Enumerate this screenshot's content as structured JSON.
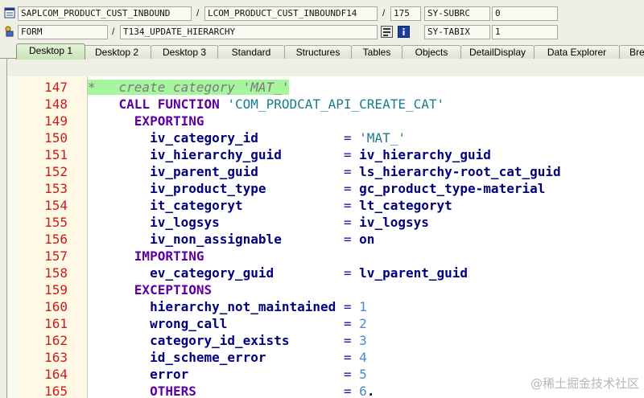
{
  "debug_fields": {
    "row1": {
      "program": "SAPLCOM_PRODUCT_CUST_INBOUND",
      "include": "LCOM_PRODUCT_CUST_INBOUNDF14",
      "line": "175",
      "sysvar_name": "SY-SUBRC",
      "sysvar_value": "0"
    },
    "row2": {
      "event_type": "FORM",
      "event_name": "T134_UPDATE_HIERARCHY",
      "sysvar_name": "SY-TABIX",
      "sysvar_value": "1"
    },
    "separator": "/"
  },
  "tabs": [
    "Desktop 1",
    "Desktop 2",
    "Desktop 3",
    "Standard",
    "Structures",
    "Tables",
    "Objects",
    "DetailDisplay",
    "Data Explorer",
    "Bre"
  ],
  "active_tab": "Desktop 1",
  "code_lines": [
    {
      "n": "147",
      "tokens": [
        {
          "t": "*   create category 'MAT_'",
          "c": "cmt"
        }
      ]
    },
    {
      "n": "148",
      "tokens": [
        {
          "t": "    "
        },
        {
          "t": "CALL FUNCTION",
          "c": "kw"
        },
        {
          "t": " "
        },
        {
          "t": "'COM_PRODCAT_API_CREATE_CAT'",
          "c": "str"
        }
      ]
    },
    {
      "n": "149",
      "tokens": [
        {
          "t": "      "
        },
        {
          "t": "EXPORTING",
          "c": "kw"
        }
      ]
    },
    {
      "n": "150",
      "tokens": [
        {
          "t": "        "
        },
        {
          "t": "iv_category_id",
          "c": "id"
        },
        {
          "t": "           "
        },
        {
          "t": "=",
          "c": "op"
        },
        {
          "t": " "
        },
        {
          "t": "'MAT_'",
          "c": "str"
        }
      ]
    },
    {
      "n": "151",
      "tokens": [
        {
          "t": "        "
        },
        {
          "t": "iv_hierarchy_guid",
          "c": "id"
        },
        {
          "t": "        "
        },
        {
          "t": "=",
          "c": "op"
        },
        {
          "t": " "
        },
        {
          "t": "iv_hierarchy_guid",
          "c": "id"
        }
      ]
    },
    {
      "n": "152",
      "tokens": [
        {
          "t": "        "
        },
        {
          "t": "iv_parent_guid",
          "c": "id"
        },
        {
          "t": "           "
        },
        {
          "t": "=",
          "c": "op"
        },
        {
          "t": " "
        },
        {
          "t": "ls_hierarchy-root_cat_guid",
          "c": "id"
        }
      ]
    },
    {
      "n": "153",
      "tokens": [
        {
          "t": "        "
        },
        {
          "t": "iv_product_type",
          "c": "id"
        },
        {
          "t": "          "
        },
        {
          "t": "=",
          "c": "op"
        },
        {
          "t": " "
        },
        {
          "t": "gc_product_type-material",
          "c": "id"
        }
      ]
    },
    {
      "n": "154",
      "tokens": [
        {
          "t": "        "
        },
        {
          "t": "it_categoryt",
          "c": "id"
        },
        {
          "t": "             "
        },
        {
          "t": "=",
          "c": "op"
        },
        {
          "t": " "
        },
        {
          "t": "lt_categoryt",
          "c": "id"
        }
      ]
    },
    {
      "n": "155",
      "tokens": [
        {
          "t": "        "
        },
        {
          "t": "iv_logsys",
          "c": "id"
        },
        {
          "t": "                "
        },
        {
          "t": "=",
          "c": "op"
        },
        {
          "t": " "
        },
        {
          "t": "iv_logsys",
          "c": "id"
        }
      ]
    },
    {
      "n": "156",
      "tokens": [
        {
          "t": "        "
        },
        {
          "t": "iv_non_assignable",
          "c": "id"
        },
        {
          "t": "        "
        },
        {
          "t": "=",
          "c": "op"
        },
        {
          "t": " "
        },
        {
          "t": "on",
          "c": "id"
        }
      ]
    },
    {
      "n": "157",
      "tokens": [
        {
          "t": "      "
        },
        {
          "t": "IMPORTING",
          "c": "kw"
        }
      ]
    },
    {
      "n": "158",
      "tokens": [
        {
          "t": "        "
        },
        {
          "t": "ev_category_guid",
          "c": "id"
        },
        {
          "t": "         "
        },
        {
          "t": "=",
          "c": "op"
        },
        {
          "t": " "
        },
        {
          "t": "lv_parent_guid",
          "c": "id"
        }
      ]
    },
    {
      "n": "159",
      "tokens": [
        {
          "t": "      "
        },
        {
          "t": "EXCEPTIONS",
          "c": "kw"
        }
      ]
    },
    {
      "n": "160",
      "tokens": [
        {
          "t": "        "
        },
        {
          "t": "hierarchy_not_maintained",
          "c": "id"
        },
        {
          "t": " "
        },
        {
          "t": "=",
          "c": "op"
        },
        {
          "t": " "
        },
        {
          "t": "1",
          "c": "num"
        }
      ]
    },
    {
      "n": "161",
      "tokens": [
        {
          "t": "        "
        },
        {
          "t": "wrong_call",
          "c": "id"
        },
        {
          "t": "               "
        },
        {
          "t": "=",
          "c": "op"
        },
        {
          "t": " "
        },
        {
          "t": "2",
          "c": "num"
        }
      ]
    },
    {
      "n": "162",
      "tokens": [
        {
          "t": "        "
        },
        {
          "t": "category_id_exists",
          "c": "id"
        },
        {
          "t": "       "
        },
        {
          "t": "=",
          "c": "op"
        },
        {
          "t": " "
        },
        {
          "t": "3",
          "c": "num"
        }
      ]
    },
    {
      "n": "163",
      "tokens": [
        {
          "t": "        "
        },
        {
          "t": "id_scheme_error",
          "c": "id"
        },
        {
          "t": "          "
        },
        {
          "t": "=",
          "c": "op"
        },
        {
          "t": " "
        },
        {
          "t": "4",
          "c": "num"
        }
      ]
    },
    {
      "n": "164",
      "tokens": [
        {
          "t": "        "
        },
        {
          "t": "error",
          "c": "id"
        },
        {
          "t": "                    "
        },
        {
          "t": "=",
          "c": "op"
        },
        {
          "t": " "
        },
        {
          "t": "5",
          "c": "num"
        }
      ]
    },
    {
      "n": "165",
      "tokens": [
        {
          "t": "        "
        },
        {
          "t": "OTHERS",
          "c": "kw"
        },
        {
          "t": "                   "
        },
        {
          "t": "=",
          "c": "op"
        },
        {
          "t": " "
        },
        {
          "t": "6",
          "c": "num"
        },
        {
          "t": ".",
          "c": "id"
        }
      ]
    }
  ],
  "watermark": "@稀土掘金技术社区",
  "colors": {
    "keyword": "#5c00a2",
    "identifier": "#00007f",
    "string": "#1a7c8c",
    "number": "#4a86d4",
    "line_number": "#cc1b1b",
    "comment_highlight": "#a8f5a0"
  }
}
